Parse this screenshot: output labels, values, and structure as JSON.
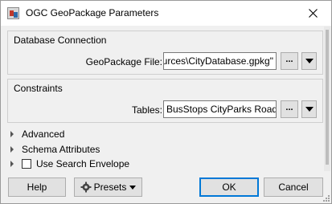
{
  "window": {
    "title": "OGC GeoPackage Parameters"
  },
  "database_connection": {
    "group_label": "Database Connection",
    "file_label": "GeoPackage File:",
    "file_value": "ources\\CityDatabase.gpkg\"",
    "browse_label": "..."
  },
  "constraints": {
    "group_label": "Constraints",
    "tables_label": "Tables:",
    "tables_value": "BusStops CityParks Roads",
    "browse_label": "..."
  },
  "sections": {
    "advanced": "Advanced",
    "schema_attributes": "Schema Attributes",
    "use_search_envelope": "Use Search Envelope"
  },
  "buttons": {
    "help": "Help",
    "presets": "Presets",
    "ok": "OK",
    "cancel": "Cancel"
  },
  "colors": {
    "default_button_border": "#0078d7"
  },
  "icons": {
    "app": "fme-workbench-icon",
    "close": "close-icon",
    "presets": "gear-icon",
    "dropdown": "chevron-down-icon",
    "expander": "chevron-right-icon",
    "resize": "resize-grip-icon"
  }
}
